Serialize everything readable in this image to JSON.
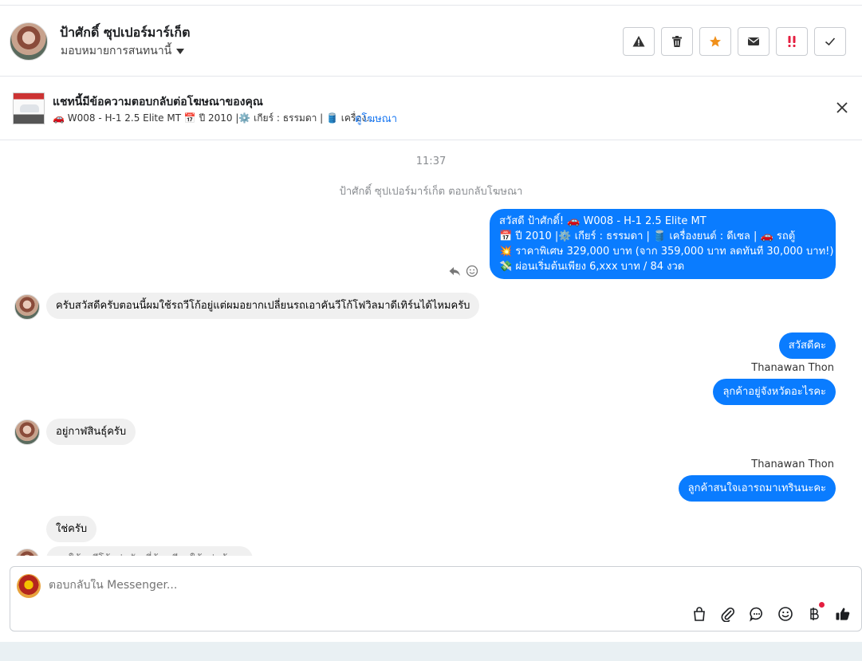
{
  "header": {
    "contact_name": "ป้าศักดิ์ ซุปเปอร์มาร์เก็ต",
    "assign_label": "มอบหมายการสนทนานี้",
    "actions": [
      {
        "name": "warning-button",
        "icon": "warning-icon"
      },
      {
        "name": "delete-button",
        "icon": "trash-icon"
      },
      {
        "name": "star-button",
        "icon": "star-icon",
        "color": "#f0901a"
      },
      {
        "name": "mark-unread-button",
        "icon": "envelope-icon"
      },
      {
        "name": "important-button",
        "icon": "double-exclamation-icon",
        "color": "#e41e3f"
      },
      {
        "name": "done-button",
        "icon": "check-icon"
      }
    ]
  },
  "banner": {
    "title": "แชทนี้มีข้อความตอบกลับต่อโฆษณาของคุณ",
    "subtitle": "🚗 W008 - H-1 2.5 Elite MT 📅 ปี 2010 |⚙️ เกียร์ : ธรรมดา | 🛢️ เครื่อง...",
    "link": "ดูโฆษณา"
  },
  "thread": {
    "time": "11:37",
    "system_text": "ป้าศักดิ์ ซุปเปอร์มาร์เก็ต ตอบกลับโฆษณา",
    "ad_message": [
      "สวัสดี ป้าศักดิ์! 🚗 W008 - H-1 2.5 Elite MT",
      "📅 ปี 2010 |⚙️ เกียร์ : ธรรมดา | 🛢️ เครื่องยนต์ : ดีเซล | 🚗 รถตู้",
      "💥 ราคาพิเศษ 329,000 บาท (จาก 359,000 บาท ลดทันที 30,000 บาท!)",
      "💸 ผ่อนเริ่มต้นเพียง 6,xxx บาท / 84 งวด"
    ],
    "msg_in_1": "ครับสวัสดีครับตอนนี้ผมใช้รถวีโก้อยู่แต่ผมอยากเปลี่ยนรถเอาคันวีโก้โฟวิลมาดีเทิร์นได้ไหมครับ",
    "msg_out_1": "สวัสดีคะ",
    "sender_1": "Thanawan Thon",
    "msg_out_2": "ลุกค้าอยู่จังหวัดอะไรคะ",
    "msg_in_2": "อยู่กาฬสินธุ์ครับ",
    "sender_2": "Thanawan Thon",
    "msg_out_3": "ลูกค้าสนใจเอารถมาเทรินนะคะ",
    "msg_in_3": "ใช่ครับ",
    "msg_in_4_partial": "ผมใช้รถวีโก้อยู่ครับ ที่บ้านมีรถใช้อยู่แล้ว..."
  },
  "composer": {
    "placeholder": "ตอบกลับใน Messenger...",
    "tools": [
      "shopping-bag-icon",
      "paperclip-icon",
      "chat-bubble-icon",
      "emoji-icon",
      "baht-icon",
      "thumbs-up-icon"
    ]
  },
  "colors": {
    "outgoing_bubble": "#0a7cff",
    "incoming_bubble": "#f0f0f0",
    "link": "#1877f2"
  }
}
